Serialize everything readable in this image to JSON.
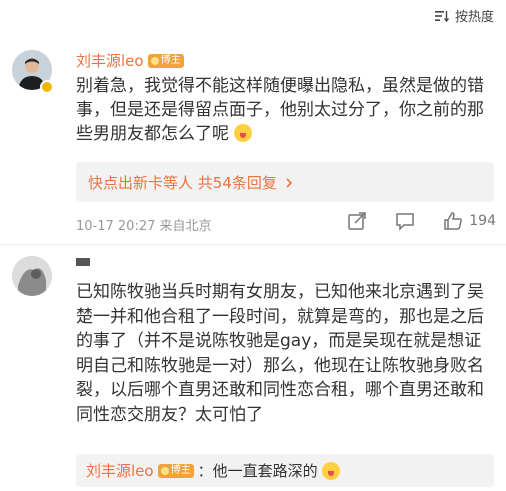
{
  "sort": {
    "label": "按热度"
  },
  "comment1": {
    "username": "刘丰源leo",
    "fan_badge": "博主",
    "text": "别着急，我觉得不能这样随便曝出隐私，虽然是做的错事，但是还是得留点面子，他别太过分了，你之前的那些男朋友都怎么了呢",
    "reply_summary": "快点出新卡等人",
    "reply_count": "共54条回复",
    "timestamp": "10-17 20:27 来自北京",
    "likes": "194"
  },
  "comment2": {
    "text": "已知陈牧驰当兵时期有女朋友，已知他来北京遇到了吴楚一并和他合租了一段时间，就算是弯的，那也是之后的事了（并不是说陈牧驰是gay，而是吴现在就是想证明自己和陈牧驰是一对）那么，他现在让陈牧驰身败名裂，以后哪个直男还敢和同性恋合租，哪个直男还敢和同性恋交朋友？太可怕了",
    "subreply_user": "刘丰源leo",
    "subreply_badge": "博主",
    "subreply_text": "：他一直套路深的"
  },
  "colors": {
    "accent": "#eb7340",
    "muted": "#999999",
    "reply_bg": "#f2f2f2"
  }
}
